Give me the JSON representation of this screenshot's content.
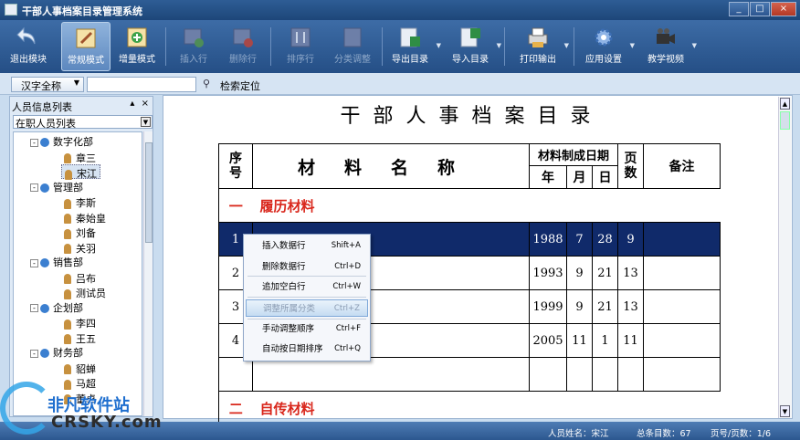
{
  "window": {
    "title": "干部人事档案目录管理系统",
    "minimize": "_",
    "maximize": "□",
    "close": "×"
  },
  "toolbar": {
    "exit": "退出模块",
    "normal_mode": "常规模式",
    "increment_mode": "增量模式",
    "insert_row": "插入行",
    "delete_row": "删除行",
    "sort_row": "排序行",
    "category_adjust": "分类调整",
    "export_catalog": "导出目录",
    "import_catalog": "导入目录",
    "print_output": "打印输出",
    "app_settings": "应用设置",
    "teaching_video": "教学视频"
  },
  "search": {
    "mode": "汉字全称",
    "value": "",
    "locate": "检索定位"
  },
  "left_panel": {
    "title": "人员信息列表",
    "pin": "▴",
    "close": "×",
    "filter": "在职人员列表",
    "tree": [
      {
        "dept": "数字化部",
        "members": [
          "章三",
          "宋江"
        ]
      },
      {
        "dept": "管理部",
        "members": [
          "李斯",
          "秦始皇",
          "刘备",
          "关羽"
        ]
      },
      {
        "dept": "销售部",
        "members": [
          "吕布",
          "测试员"
        ]
      },
      {
        "dept": "企划部",
        "members": [
          "李四",
          "王五"
        ]
      },
      {
        "dept": "财务部",
        "members": [
          "貂蝉",
          "马超",
          "董卓"
        ]
      }
    ],
    "selected": "宋江"
  },
  "document": {
    "title": "干部人事档案目录",
    "headers": {
      "seq": "序号",
      "name": "材料名称",
      "date_group": "材料制成日期",
      "year": "年",
      "month": "月",
      "day": "日",
      "pages": "页数",
      "note": "备注"
    },
    "categories": [
      {
        "num": "一",
        "name": "履历材料"
      },
      {
        "num": "二",
        "name": "自传材料"
      }
    ],
    "rows": [
      {
        "seq": "1",
        "name": "",
        "year": "1988",
        "month": "7",
        "day": "28",
        "pages": "9",
        "note": ""
      },
      {
        "seq": "2",
        "name": "",
        "year": "1993",
        "month": "9",
        "day": "21",
        "pages": "13",
        "note": ""
      },
      {
        "seq": "3",
        "name": "",
        "year": "1999",
        "month": "9",
        "day": "21",
        "pages": "13",
        "note": ""
      },
      {
        "seq": "4",
        "name": "",
        "year": "2005",
        "month": "11",
        "day": "1",
        "pages": "11",
        "note": ""
      }
    ]
  },
  "context_menu": [
    {
      "label": "插入数据行",
      "shortcut": "Shift+A"
    },
    {
      "label": "删除数据行",
      "shortcut": "Ctrl+D"
    },
    {
      "label": "追加空白行",
      "shortcut": "Ctrl+W"
    },
    {
      "label": "调整所属分类",
      "shortcut": "Ctrl+Z"
    },
    {
      "label": "手动调整顺序",
      "shortcut": "Ctrl+F"
    },
    {
      "label": "自动按日期排序",
      "shortcut": "Ctrl+Q"
    }
  ],
  "status": {
    "person": "人员姓名：宋江",
    "total": "总条目数：67",
    "page": "页号/页数：1/6"
  },
  "watermark": {
    "text": "非凡软件站",
    "url": "CRSKY.com"
  },
  "colors": {
    "titlebar": "#1d4679",
    "toolbar": "#2f5e98",
    "selected_row": "#102a6a",
    "category_red": "#d9271c"
  }
}
